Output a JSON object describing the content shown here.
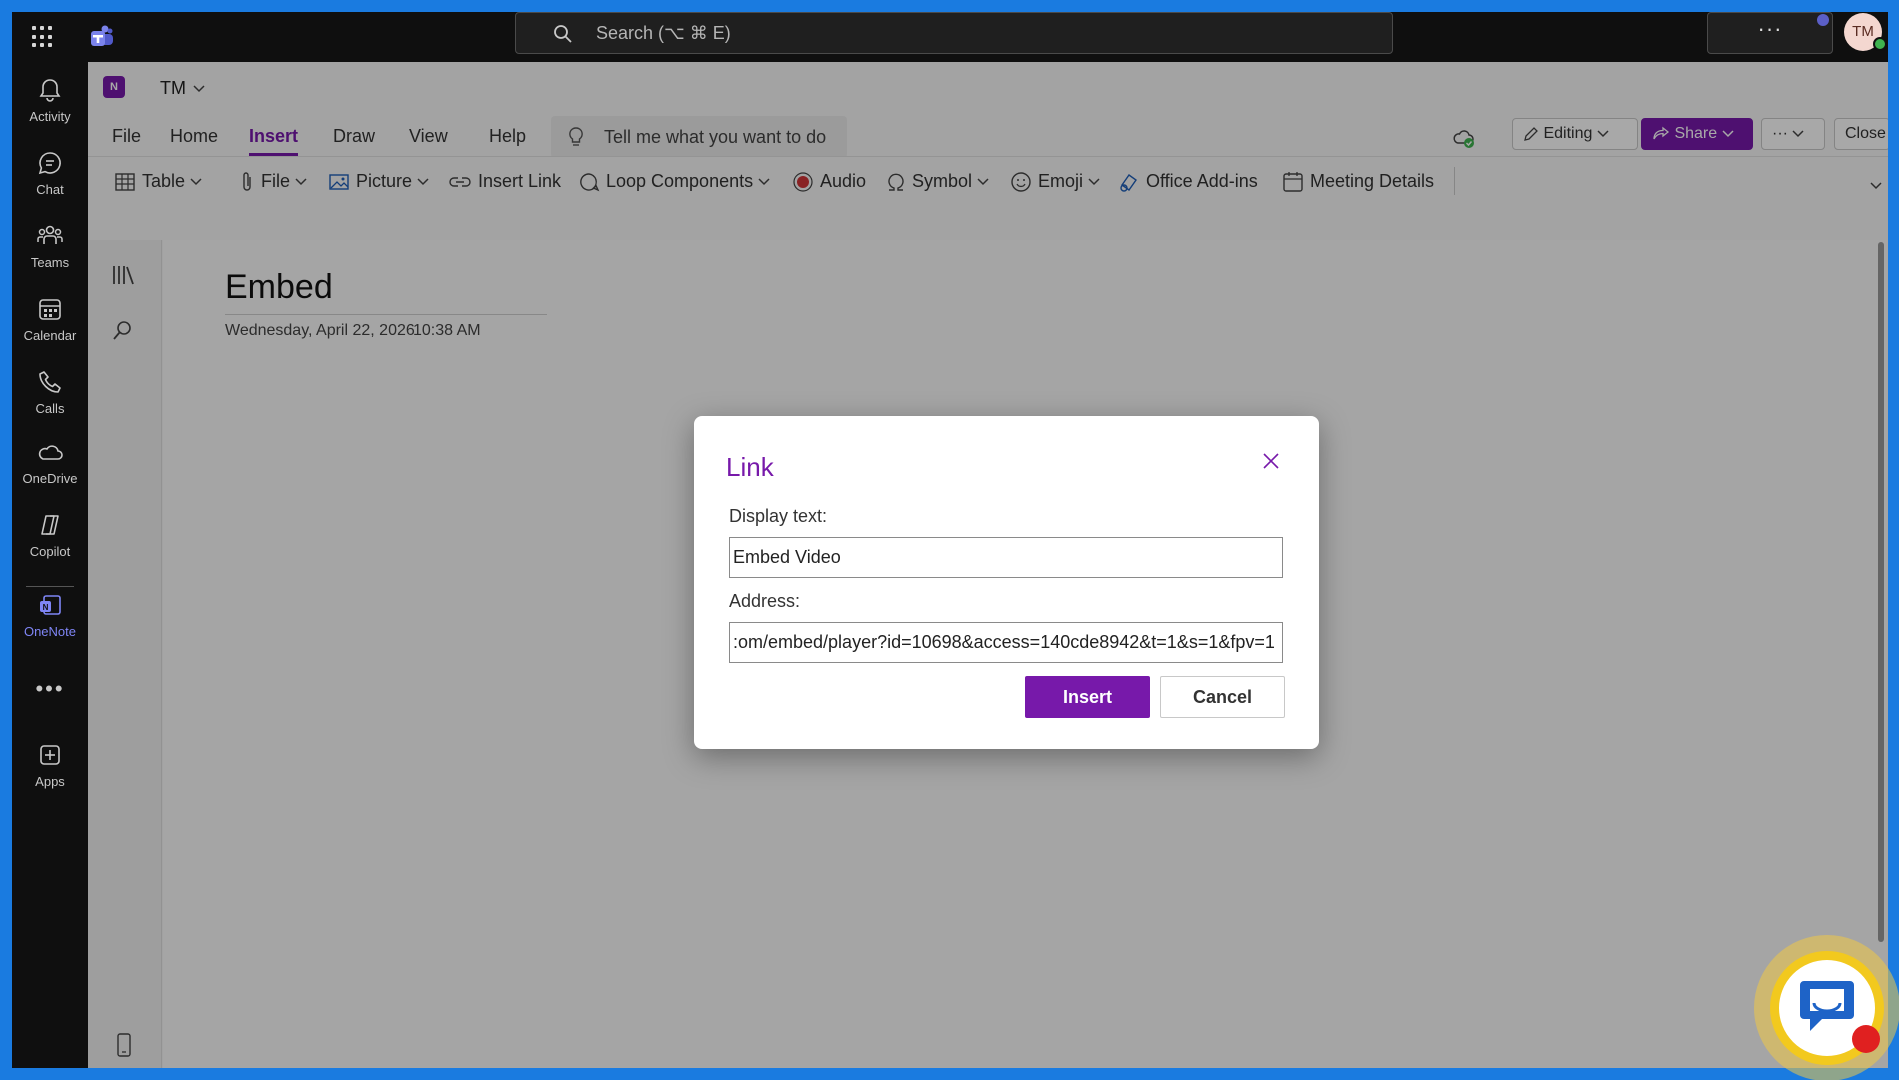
{
  "topbar": {
    "search_placeholder": "Search (⌥ ⌘ E)",
    "more_label": "···",
    "avatar_initials": "TM"
  },
  "rail": {
    "items": [
      {
        "label": "Activity",
        "icon": "bell-icon"
      },
      {
        "label": "Chat",
        "icon": "chat-icon"
      },
      {
        "label": "Teams",
        "icon": "teams-icon"
      },
      {
        "label": "Calendar",
        "icon": "calendar-icon"
      },
      {
        "label": "Calls",
        "icon": "phone-icon"
      },
      {
        "label": "OneDrive",
        "icon": "cloud-icon"
      },
      {
        "label": "Copilot",
        "icon": "copilot-icon"
      },
      {
        "label": "OneNote",
        "icon": "onenote-icon",
        "active": true
      },
      {
        "label": "Apps",
        "icon": "plus-icon"
      }
    ],
    "more_label": "•••"
  },
  "app": {
    "notebook": "TM",
    "tabs": [
      "File",
      "Home",
      "Insert",
      "Draw",
      "View",
      "Help"
    ],
    "active_tab": "Insert",
    "tell_me": "Tell me what you want to do",
    "editing_label": "Editing",
    "share_label": "Share",
    "more_label": "···",
    "close_label": "Close"
  },
  "ribbon": {
    "table": "Table",
    "file": "File",
    "picture": "Picture",
    "insert_link": "Insert Link",
    "loop": "Loop Components",
    "audio": "Audio",
    "symbol": "Symbol",
    "emoji": "Emoji",
    "addins": "Office Add-ins",
    "meeting": "Meeting Details"
  },
  "page": {
    "title": "Embed",
    "date": "Wednesday, April 22, 2026",
    "time": "10:38 AM"
  },
  "dialog": {
    "title": "Link",
    "display_label": "Display text:",
    "display_value": "Embed Video",
    "address_label": "Address:",
    "address_value": ":om/embed/player?id=10698&access=140cde8942&t=1&s=1&fpv=1",
    "insert_label": "Insert",
    "cancel_label": "Cancel"
  },
  "colors": {
    "accent": "#7719aa",
    "teams_purple": "#7f85f5",
    "frame_blue": "#1a7be0"
  }
}
